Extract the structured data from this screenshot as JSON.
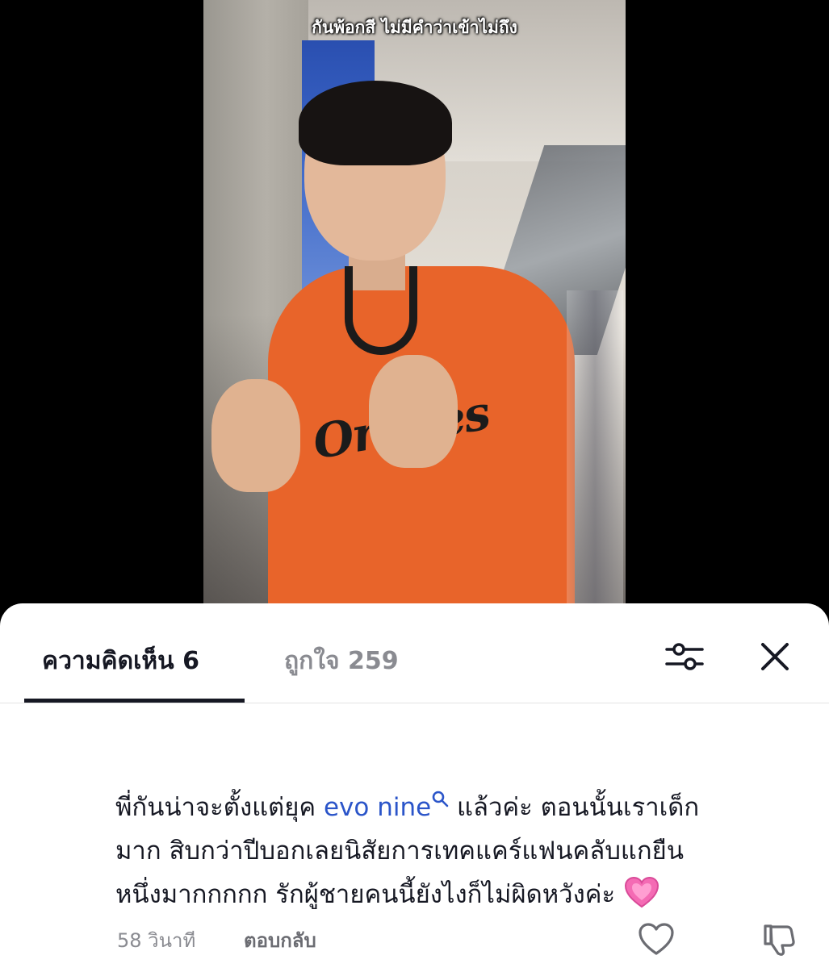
{
  "video": {
    "caption": "กันพ้อกสี ไม่มีคำว่าเข้าไม่ถึง",
    "shirt_text": "Orioles"
  },
  "tabs": [
    {
      "label": "ความคิดเห็น 6",
      "active": true
    },
    {
      "label": "ถูกใจ 259",
      "active": false
    }
  ],
  "icons": {
    "filter": "filter-sliders-icon",
    "close": "close-icon",
    "like": "heart-outline-icon",
    "dislike": "thumbs-down-icon",
    "mention_search": "search-icon",
    "emoji": "pink-heart-emoji"
  },
  "comment": {
    "line1_before": "พี่กันน่าจะตั้งแต่ยุค ",
    "mention": "evo nine",
    "line1_after": " แล้วค่ะ ตอนนั้นเราเด็ก",
    "line2": "มาก สิบกว่าปีบอกเลยนิสัยการเทคแคร์แฟนคลับแกยืน",
    "line3": "หนึ่งมากกกกก รักผู้ชายคนนี้ยังไงก็ไม่ผิดหวังค่ะ ",
    "time": "58 วินาที",
    "reply": "ตอบกลับ"
  },
  "colors": {
    "mention": "#2b55c9",
    "active_tab": "#161823",
    "inactive_tab": "#8a8b91",
    "shirt": "#e8642a"
  }
}
